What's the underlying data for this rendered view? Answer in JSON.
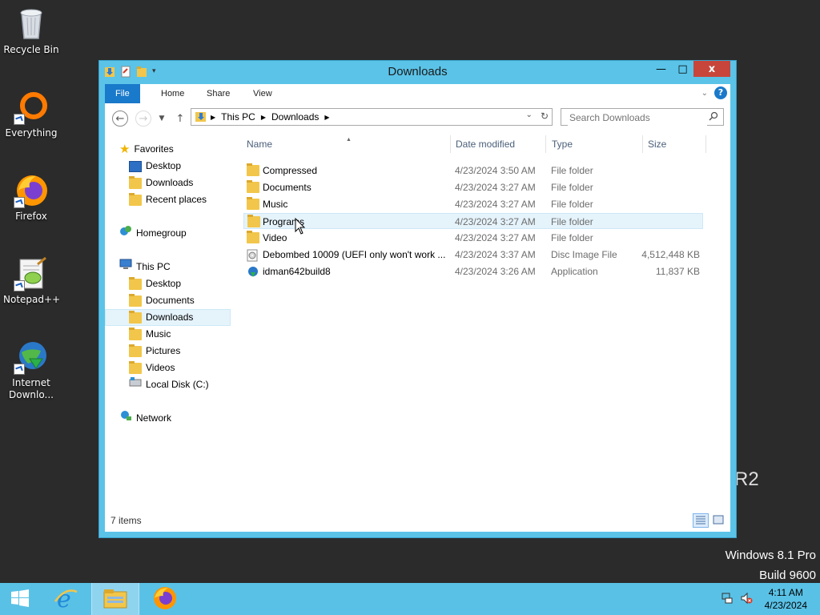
{
  "desktop": {
    "icons": [
      {
        "label": "Recycle Bin",
        "icon": "recycle-bin-icon"
      },
      {
        "label": "Everything",
        "icon": "everything-icon"
      },
      {
        "label": "Firefox",
        "icon": "firefox-icon"
      },
      {
        "label": "Notepad++",
        "icon": "notepad-plus-plus-icon"
      },
      {
        "label": "Internet Downlo...",
        "icon": "internet-download-manager-icon"
      }
    ],
    "watermark_line1": "Windows 8.1 Pro",
    "watermark_line2": "Build 9600",
    "r2_text": "R2"
  },
  "window": {
    "title": "Downloads",
    "minimize": "—",
    "maximize": "□",
    "close": "x",
    "ribbon_tabs": [
      "File",
      "Home",
      "Share",
      "View"
    ],
    "help": "?",
    "address": {
      "crumbs": [
        "This PC",
        "Downloads"
      ]
    },
    "search": {
      "placeholder": "Search Downloads"
    },
    "nav": {
      "favorites": "Favorites",
      "favorites_items": [
        "Desktop",
        "Downloads",
        "Recent places"
      ],
      "homegroup": "Homegroup",
      "thispc": "This PC",
      "thispc_items": [
        "Desktop",
        "Documents",
        "Downloads",
        "Music",
        "Pictures",
        "Videos",
        "Local Disk (C:)"
      ],
      "network": "Network",
      "selected": "Downloads"
    },
    "columns": {
      "name": "Name",
      "date": "Date modified",
      "type": "Type",
      "size": "Size"
    },
    "files": [
      {
        "name": "Compressed",
        "date": "4/23/2024 3:50 AM",
        "type": "File folder",
        "size": ""
      },
      {
        "name": "Documents",
        "date": "4/23/2024 3:27 AM",
        "type": "File folder",
        "size": ""
      },
      {
        "name": "Music",
        "date": "4/23/2024 3:27 AM",
        "type": "File folder",
        "size": ""
      },
      {
        "name": "Programs",
        "date": "4/23/2024 3:27 AM",
        "type": "File folder",
        "size": ""
      },
      {
        "name": "Video",
        "date": "4/23/2024 3:27 AM",
        "type": "File folder",
        "size": ""
      },
      {
        "name": "Debombed 10009 (UEFI only won't work ...",
        "date": "4/23/2024 3:37 AM",
        "type": "Disc Image File",
        "size": "4,512,448 KB"
      },
      {
        "name": "idman642build8",
        "date": "4/23/2024 3:26 AM",
        "type": "Application",
        "size": "11,837 KB"
      }
    ],
    "status": "7 items"
  },
  "taskbar": {
    "time": "4:11 AM",
    "date": "4/23/2024",
    "items": [
      "start-icon",
      "internet-explorer-icon",
      "file-explorer-icon",
      "firefox-icon"
    ]
  },
  "colors": {
    "accent": "#1979ca",
    "titlebar": "#5bc3e8",
    "taskbar": "#5ac1e6",
    "close": "#c7453b",
    "desktop": "#2b2b2b"
  }
}
